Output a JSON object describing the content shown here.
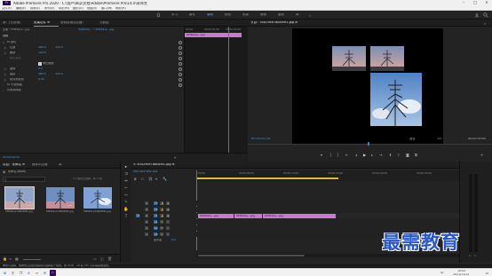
{
  "window": {
    "title": "Adobe Premiere Pro 2020 - C:\\用户\\dkp\\文档\\Adobe\\Premiere Pro\\14.0\\未命名",
    "app_icon": "Pr"
  },
  "menu": [
    "文件(F)",
    "编辑(E)",
    "剪辑(C)",
    "序列(S)",
    "标记(M)",
    "图形(G)",
    "视图(V)",
    "窗口(W)",
    "帮助(H)"
  ],
  "workspaces": [
    "学习",
    "组件",
    "编辑",
    "颜色",
    "效果",
    "音频",
    "图形",
    "库"
  ],
  "workspaces_active_index": 2,
  "effect_controls": {
    "tabs": [
      "源：(无剪辑)",
      "效果控件 ≡",
      "音频剪辑混合器：",
      "元数据"
    ],
    "source_clip": "主要 * 5f4f29ce...jpg",
    "sequence_clip": "5f4f29ce... * 5f4f29ce...jpg",
    "timecodes": [
      "00:00",
      "00:00:01:00",
      "00:00:02:00"
    ],
    "clip_label": "5f4f29ce...jpg",
    "section_video": "视频",
    "rows": [
      {
        "type": "section",
        "label": "fx  运动"
      },
      {
        "type": "prop",
        "label": "位置",
        "v1": "480.0",
        "v2": "330.0"
      },
      {
        "type": "prop",
        "label": "缩放",
        "v1": "100.0",
        "v2": ""
      },
      {
        "type": "prop",
        "label": "缩放宽度",
        "v1": "",
        "v2": ""
      },
      {
        "type": "check",
        "label": "等比缩放"
      },
      {
        "type": "prop",
        "label": "旋转",
        "v1": "0.0",
        "v2": ""
      },
      {
        "type": "prop",
        "label": "锚点",
        "v1": "480.0",
        "v2": "330.0"
      },
      {
        "type": "prop",
        "label": "防闪烁滤镜",
        "v1": "0.00",
        "v2": ""
      },
      {
        "type": "section",
        "label": "fx  不透明度"
      },
      {
        "type": "section",
        "label": "  时间重映射"
      }
    ],
    "current_time": "00:00:00:00"
  },
  "program_monitor": {
    "title": "节目：5f4f29ce7d8c89f1.jpg ≡",
    "timecode": "00:00:02:16",
    "fit": "适合",
    "quality": "1/2",
    "duration": "00:00:05:00"
  },
  "project": {
    "tabs": [
      "项目：未命名 ≡",
      "媒体浏览器",
      "库"
    ],
    "project_name": "未命名.prproj",
    "search_placeholder": "",
    "item_count": "1个项目已选择，共 3 项",
    "items": [
      {
        "name": "5f4f29ce7d8c89f1.jpg",
        "duration": "5:00"
      },
      {
        "name": "5f4f29ce7d8c89f1.jpg",
        "duration": "5:00"
      },
      {
        "name": "5f4f29ce7d8c89f1.jpg",
        "duration": "5:00"
      }
    ]
  },
  "timeline": {
    "tab": "× 5f4f29ce7d8c89f1.jpg ≡",
    "timecode": "00:00:00:00",
    "ruler": [
      "00:00",
      "00:00:05:00",
      "00:00:10:00",
      "00:00:15:00",
      "00:00:20:00",
      "00:00:25:00"
    ],
    "tracks": [
      "V3",
      "V2",
      "V1",
      "A1",
      "A2",
      "A3",
      "主声道"
    ],
    "master_value": "0.0",
    "clips": [
      {
        "track": "V1",
        "name": "5f4f29ce...jpg"
      },
      {
        "track": "V1",
        "name": "5f4f29ce...jpg"
      },
      {
        "track": "V1",
        "name": "5f4f29ce...jpg"
      }
    ],
    "tooltip": "5f4f29ce...jpg"
  },
  "status_bar": "单击以选择，或单击空白处并拖动以选择多个剪辑。按 Shift、Alt 和 Ctrl 可获得其他选项。",
  "taskbar": {
    "time": "10:03",
    "date": "2021/11/12",
    "lang": "中",
    "icons": [
      "windows-icon",
      "search-icon",
      "task-view-icon",
      "edge-icon",
      "explorer-icon",
      "mail-icon",
      "premiere-icon"
    ]
  },
  "watermark": "最需教育",
  "colors": {
    "accent": "#4a9fe8",
    "clip": "#c87ad0",
    "watermark": "#2a57c8"
  }
}
